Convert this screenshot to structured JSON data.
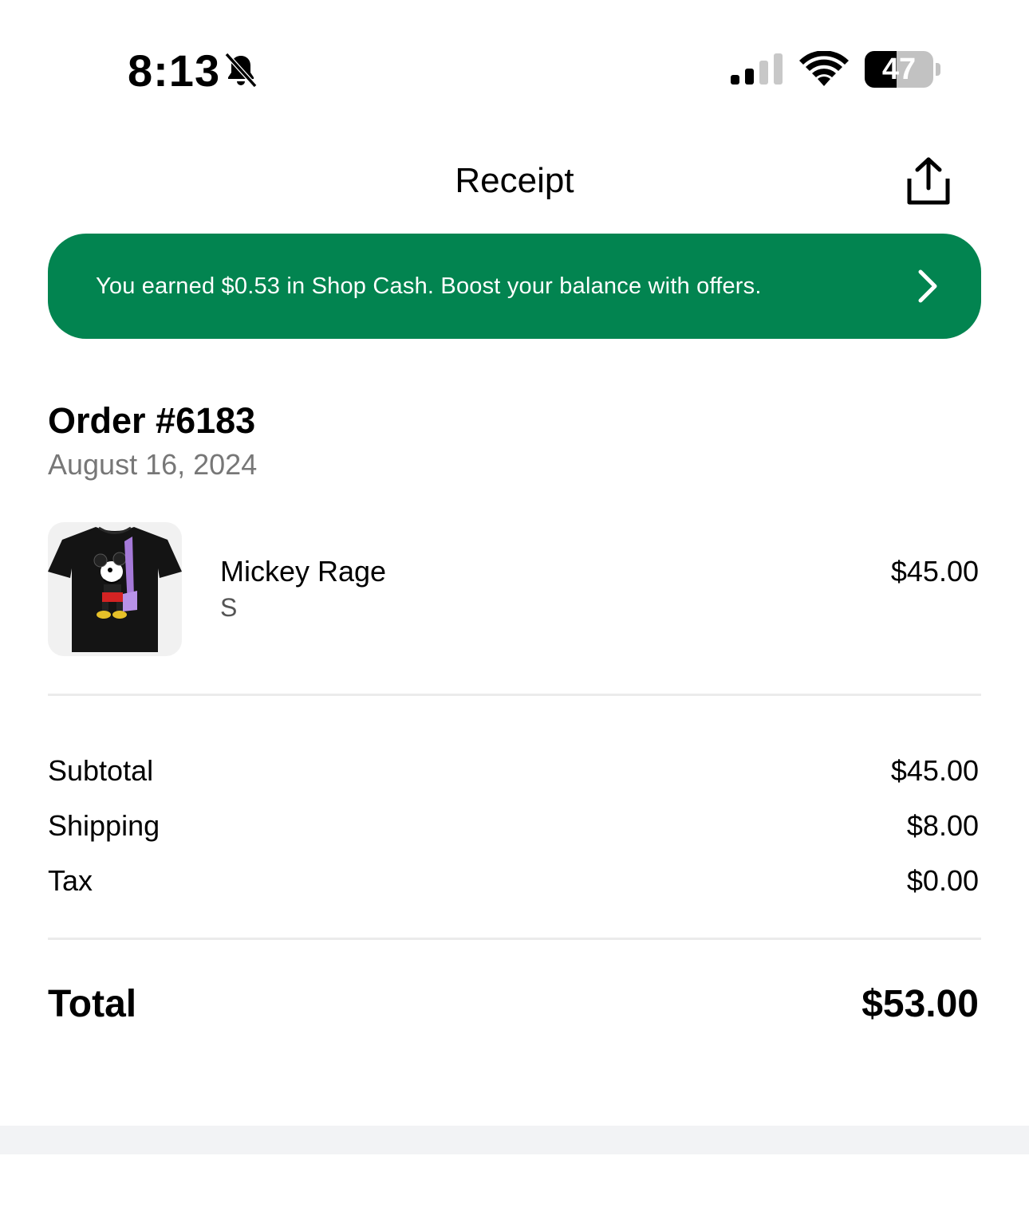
{
  "status_bar": {
    "time": "8:13",
    "battery_level": "47",
    "battery_fraction": 0.47,
    "icons": [
      "bell-slash-icon",
      "cellular-signal-icon",
      "wifi-icon",
      "battery-icon"
    ]
  },
  "header": {
    "title": "Receipt",
    "share_icon": "share-icon"
  },
  "banner": {
    "text": "You earned $0.53 in Shop Cash. Boost your balance with offers.",
    "icon": "chevron-right-icon",
    "color": "#028450"
  },
  "order": {
    "title": "Order #6183",
    "date": "August 16, 2024"
  },
  "items": [
    {
      "name": "Mickey Rage",
      "variant": "S",
      "price": "$45.00",
      "thumbnail": "black-tshirt-image"
    }
  ],
  "summary": {
    "subtotal_label": "Subtotal",
    "subtotal_value": "$45.00",
    "shipping_label": "Shipping",
    "shipping_value": "$8.00",
    "tax_label": "Tax",
    "tax_value": "$0.00",
    "total_label": "Total",
    "total_value": "$53.00"
  }
}
